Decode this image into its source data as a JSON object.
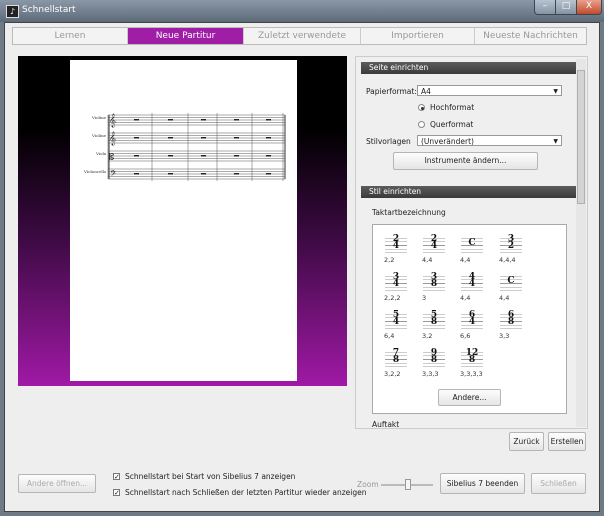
{
  "window": {
    "title": "Schnellstart",
    "min_glyph": "–",
    "max_glyph": "□",
    "close_glyph": "X"
  },
  "tabs": [
    {
      "label": "Lernen"
    },
    {
      "label": "Neue Partitur"
    },
    {
      "label": "Zuletzt verwendete"
    },
    {
      "label": "Importieren"
    },
    {
      "label": "Neueste Nachrichten"
    }
  ],
  "score": {
    "instruments": [
      "Violine",
      "Violine",
      "Viola",
      "Violoncello"
    ]
  },
  "page_setup": {
    "header": "Seite einrichten",
    "paper_label": "Papierformat:",
    "paper_value": "A4",
    "orientation": [
      {
        "label": "Hochformat",
        "selected": true
      },
      {
        "label": "Querformat",
        "selected": false
      }
    ],
    "style_label": "Stilvorlagen",
    "style_value": "(Unverändert)",
    "instruments_button": "Instrumente ändern..."
  },
  "style_setup": {
    "header": "Stil einrichten",
    "time_sig_label": "Taktartbezeichnung",
    "time_signatures": [
      {
        "top": "2",
        "bottom": "4",
        "caption": "2,2"
      },
      {
        "top": "2",
        "bottom": "4",
        "caption": "4,4"
      },
      {
        "top": "C",
        "bottom": "",
        "caption": "4,4"
      },
      {
        "top": "3",
        "bottom": "2",
        "caption": "4,4,4"
      },
      {
        "top": "3",
        "bottom": "4",
        "caption": "2,2,2"
      },
      {
        "top": "3",
        "bottom": "8",
        "caption": "3"
      },
      {
        "top": "4",
        "bottom": "4",
        "caption": "4,4"
      },
      {
        "top": "C",
        "bottom": "",
        "caption": "4,4"
      },
      {
        "top": "5",
        "bottom": "4",
        "caption": "6,4"
      },
      {
        "top": "5",
        "bottom": "8",
        "caption": "3,2"
      },
      {
        "top": "6",
        "bottom": "4",
        "caption": "6,6"
      },
      {
        "top": "6",
        "bottom": "8",
        "caption": "3,3"
      },
      {
        "top": "7",
        "bottom": "8",
        "caption": "3,2,2"
      },
      {
        "top": "9",
        "bottom": "8",
        "caption": "3,3,3"
      },
      {
        "top": "12",
        "bottom": "8",
        "caption": "3,3,3,3"
      }
    ],
    "other_button": "Andere...",
    "pickup_label": "Auftakt"
  },
  "actions": {
    "back": "Zurück",
    "create": "Erstellen"
  },
  "footer": {
    "open_other": "Andere öffnen...",
    "show_on_start": "Schnellstart bei Start von Sibelius 7 anzeigen",
    "show_on_close": "Schnellstart nach Schließen der letzten Partitur wieder anzeigen",
    "zoom_label": "Zoom",
    "quit": "Sibelius 7 beenden",
    "close": "Schließen"
  },
  "colors": {
    "accent": "#a01ea6"
  }
}
